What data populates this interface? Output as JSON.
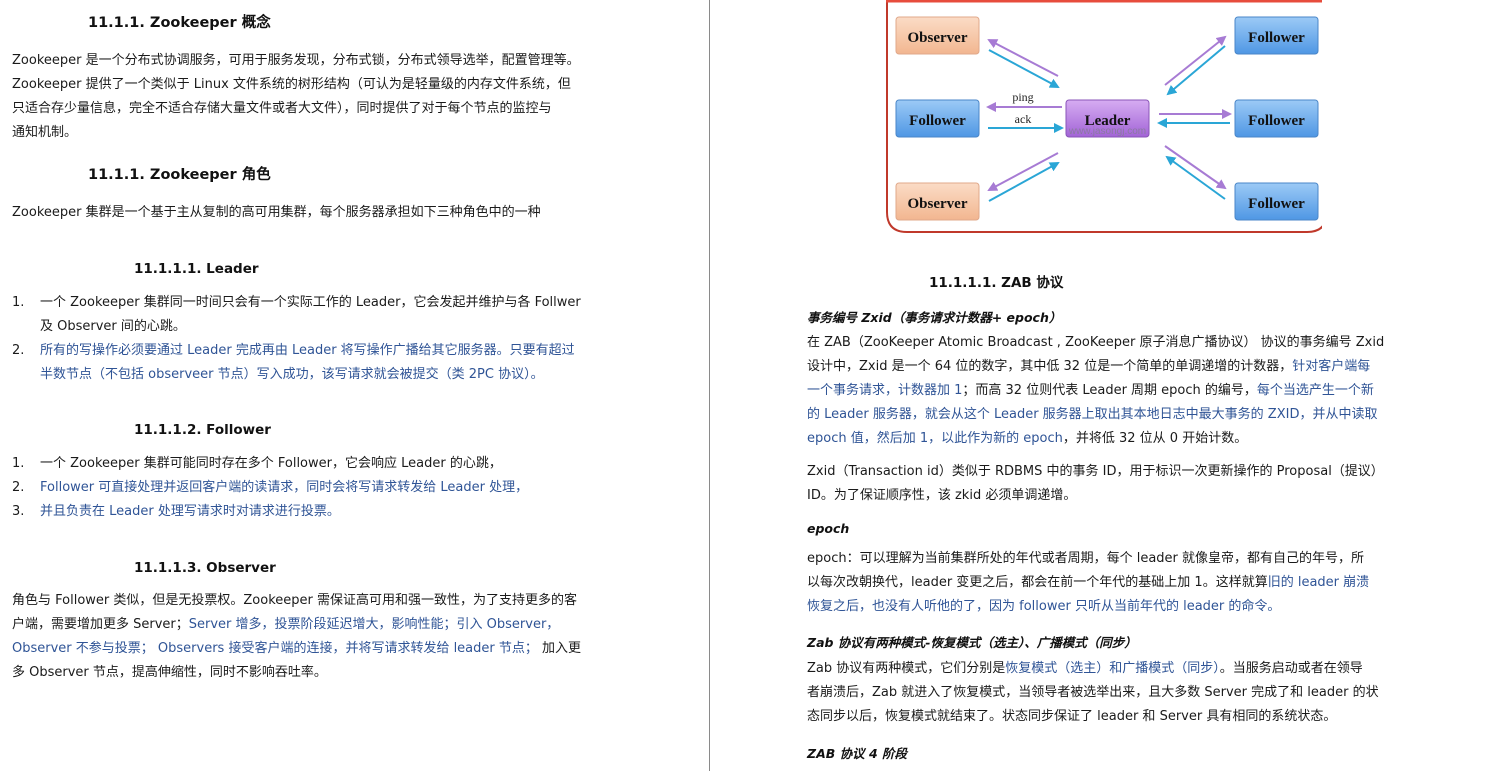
{
  "left": {
    "h_concept": "11.1.1.    Zookeeper 概念",
    "concept_lines": [
      "Zookeeper  是一个分布式协调服务，可用于服务发现，分布式锁，分布式领导选举，配置管理等。",
      "Zookeeper  提供了一个类似于  Linux  文件系统的树形结构（可认为是轻量级的内存文件系统，但",
      "只适合存少量信息，完全不适合存储大量文件或者大文件），同时提供了对于每个节点的监控与",
      "通知机制。"
    ],
    "h_roles": "11.1.1.    Zookeeper 角色",
    "roles_intro": "Zookeeper 集群是一个基于主从复制的高可用集群，每个服务器承担如下三种角色中的一种",
    "h_leader": "11.1.1.1.  Leader",
    "leader_items": [
      {
        "num": "1.",
        "lines": [
          "一个 Zookeeper 集群同一时间只会有一个实际工作的 Leader，它会发起并维护与各 Follwer",
          "及 Observer 间的心跳。"
        ],
        "highlight": false
      },
      {
        "num": "2.",
        "lines": [
          "所有的写操作必须要通过 Leader 完成再由 Leader 将写操作广播给其它服务器。只要有超过",
          "半数节点（不包括 observeer 节点）写入成功，该写请求就会被提交（类 2PC 协议）。"
        ],
        "highlight": true
      }
    ],
    "h_follower": "11.1.1.2.  Follower",
    "follower_items": [
      {
        "num": "1.",
        "text": "一个 Zookeeper 集群可能同时存在多个 Follower，它会响应 Leader 的心跳，",
        "highlight": false
      },
      {
        "num": "2.",
        "text": "Follower 可直接处理并返回客户端的读请求，同时会将写请求转发给 Leader 处理，",
        "highlight": true
      },
      {
        "num": "3.",
        "text": "并且负责在 Leader 处理写请求时对请求进行投票。",
        "highlight": true
      }
    ],
    "h_observer": "11.1.1.3.  Observer",
    "observer_lines": [
      [
        {
          "t": "角色与 Follower 类似，但是无投票权。Zookeeper 需保证高可用和强一致性，为了支持更多的客",
          "b": false
        }
      ],
      [
        {
          "t": "户端，需要增加更多  Server；",
          "b": false
        },
        {
          "t": "Server  增多，投票阶段延迟增大，影响性能；引入  Observer，",
          "b": true
        }
      ],
      [
        {
          "t": "Observer 不参与投票；  Observers 接受客户端的连接，并将写请求转发给 leader 节点；",
          "b": true
        },
        {
          "t": "  加入更",
          "b": false
        }
      ],
      [
        {
          "t": "多 Observer 节点，提高伸缩性，同时不影响吞吐率。",
          "b": false
        }
      ]
    ]
  },
  "diagram": {
    "nodes": {
      "observer_top": "Observer",
      "observer_bottom": "Observer",
      "follower_left": "Follower",
      "follower_top_right": "Follower",
      "follower_mid_right": "Follower",
      "follower_bottom_right": "Follower",
      "leader": "Leader"
    },
    "label_ping": "ping",
    "label_ack": "ack",
    "watermark": "www.jasongj.com",
    "colors": {
      "frame": "#c0392b",
      "observer_fill": "#f6c8a8",
      "follower_fill": "#6fb0ee",
      "leader_fill": "#b67ae0",
      "ping_arrow": "#a77bd4",
      "ack_arrow": "#2aa6d6"
    }
  },
  "right": {
    "h_zab": "11.1.1.1.  ZAB 协议",
    "zxid_title": "事务编号 Zxid（事务请求计数器+ epoch）",
    "zxid_lines": [
      [
        {
          "t": "在 ZAB（ZooKeeper Atomic Broadcast , ZooKeeper 原子消息广播协议） 协议的事务编号 Zxid",
          "b": false
        }
      ],
      [
        {
          "t": "设计中，Zxid 是一个 64 位的数字，其中低 32 位是一个简单的单调递增的计数器，",
          "b": false
        },
        {
          "t": "针对客户端每",
          "b": true
        }
      ],
      [
        {
          "t": "一个事务请求，计数器加 1",
          "b": true
        },
        {
          "t": "；而高 32 位则代表 Leader 周期 epoch 的编号，",
          "b": false
        },
        {
          "t": "每个当选产生一个新",
          "b": true
        }
      ],
      [
        {
          "t": "的 Leader 服务器，就会从这个 Leader 服务器上取出其本地日志中最大事务的 ZXID，并从中读取",
          "b": true
        }
      ],
      [
        {
          "t": "epoch 值，然后加 1，以此作为新的 epoch",
          "b": true
        },
        {
          "t": "，并将低 32 位从 0 开始计数。",
          "b": false
        }
      ]
    ],
    "zxid2_lines": [
      "Zxid（Transaction id）类似于 RDBMS 中的事务 ID，用于标识一次更新操作的 Proposal（提议）",
      "ID。为了保证顺序性，该 zkid 必须单调递增。"
    ],
    "epoch_title": "epoch",
    "epoch_lines": [
      [
        {
          "t": "epoch：可以理解为当前集群所处的年代或者周期，每个  leader  就像皇帝，都有自己的年号，所",
          "b": false
        }
      ],
      [
        {
          "t": "以每次改朝换代，leader 变更之后，都会在前一个年代的基础上加 1。这样就算",
          "b": false
        },
        {
          "t": "旧的 leader 崩溃",
          "b": true
        }
      ],
      [
        {
          "t": "恢复之后，也没有人听他的了，因为 follower 只听从当前年代的 leader 的命令。",
          "b": true
        }
      ]
    ],
    "modes_title": "Zab 协议有两种模式-恢复模式（选主）、广播模式（同步）",
    "modes_lines": [
      [
        {
          "t": "Zab 协议有两种模式，它们分别是",
          "b": false
        },
        {
          "t": "恢复模式（选主）和广播模式（同步）",
          "b": true
        },
        {
          "t": "。当服务启动或者在领导",
          "b": false
        }
      ],
      [
        {
          "t": "者崩溃后，Zab 就进入了恢复模式，当领导者被选举出来，且大多数 Server 完成了和 leader 的状",
          "b": false
        }
      ],
      [
        {
          "t": "态同步以后，恢复模式就结束了。状态同步保证了 leader 和 Server 具有相同的系统状态。",
          "b": false
        }
      ]
    ],
    "phases_title": "ZAB 协议 4 阶段"
  }
}
